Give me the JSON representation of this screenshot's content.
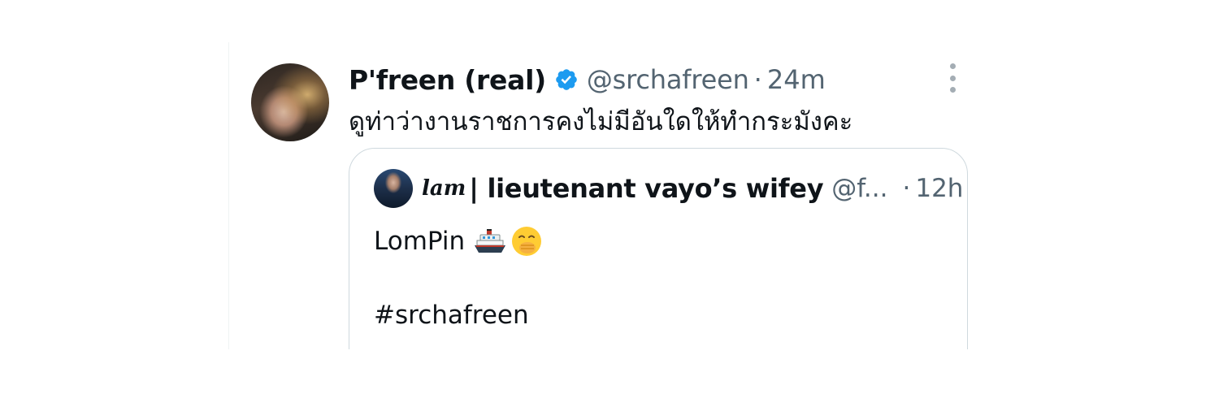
{
  "tweet": {
    "display_name": "P'freen (real)",
    "handle": "@srchafreen",
    "separator": "·",
    "time": "24m",
    "text": "ดูท่าว่างานราชการคงไม่มีอันใดให้ทำกระมังคะ",
    "verified_icon": "verified-badge-icon",
    "more_icon": "more-vertical-icon"
  },
  "quote": {
    "script_name": "lam",
    "display_name": "| lieutenant vayo’s wifey",
    "handle": "@f...",
    "separator": "·",
    "time": "12h",
    "line1": "LomPin",
    "ship_icon": "ship-emoji",
    "face_icon": "hand-over-mouth-emoji",
    "hashtag": "#srchafreen"
  },
  "colors": {
    "text_primary": "#0f1419",
    "text_secondary": "#536471",
    "verified_blue": "#1d9bf0",
    "border": "#cfd9de"
  }
}
